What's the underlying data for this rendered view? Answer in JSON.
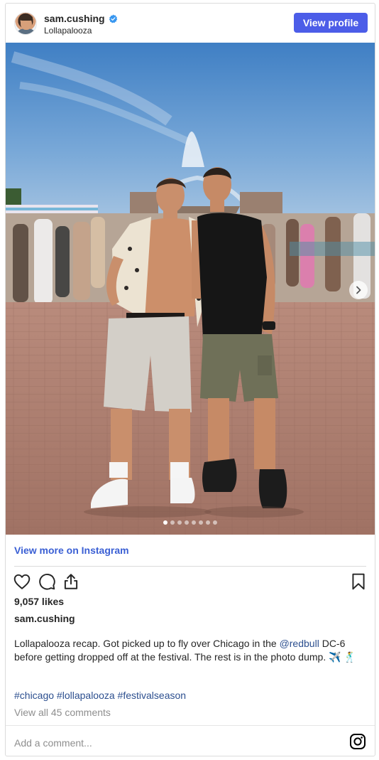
{
  "post": {
    "username": "sam.cushing",
    "location": "Lollapalooza",
    "view_profile_label": "View profile",
    "view_more_label": "View more on Instagram",
    "likes": "9,057 likes",
    "caption_user": "sam.cushing",
    "caption_part1": "Lollapalooza recap. Got picked up to fly over Chicago in the ",
    "caption_mention": "@redbull",
    "caption_part2": " DC-6 before getting dropped off at the festival. The rest is in the photo dump. ✈️ 🕺",
    "hashtags": "#chicago #lollapalooza #festivalseason",
    "view_comments": "View all 45 comments",
    "add_comment_placeholder": "Add a comment...",
    "carousel_total": 8,
    "carousel_active": 1
  },
  "icons": {
    "verified": "verified-badge-icon",
    "like": "heart-icon",
    "comment": "comment-bubble-icon",
    "share": "share-icon",
    "save": "bookmark-icon",
    "next": "chevron-right-icon",
    "instagram": "instagram-logo-icon"
  },
  "colors": {
    "button": "#4c5de8",
    "link": "#3a5fd4",
    "mention": "#2c4f8f",
    "verified": "#3897f0"
  }
}
